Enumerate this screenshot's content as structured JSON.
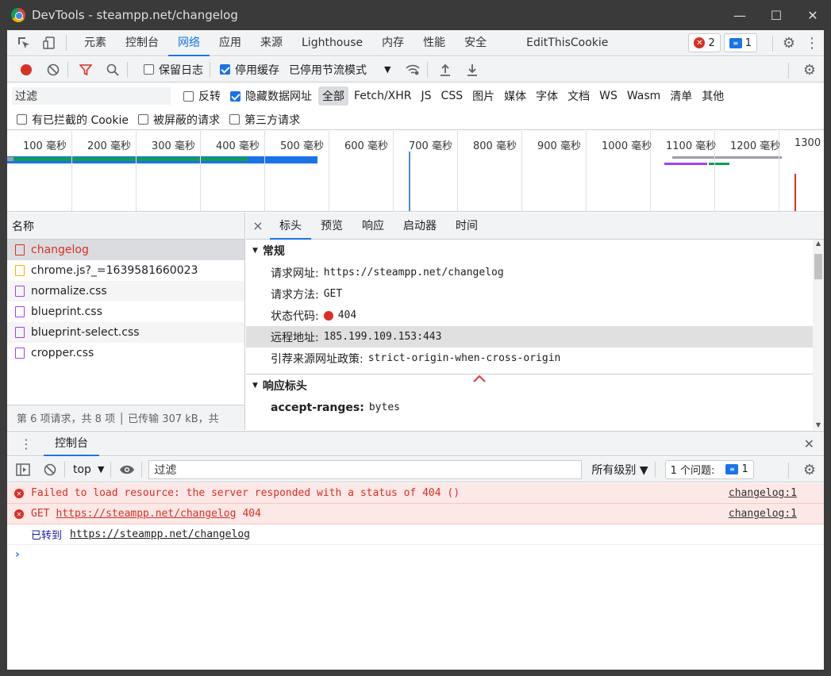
{
  "window": {
    "title": "DevTools - steampp.net/changelog",
    "minimize": "—",
    "maximize": "☐",
    "close": "✕"
  },
  "main_tabs": {
    "items": [
      "元素",
      "控制台",
      "网络",
      "应用",
      "来源",
      "Lighthouse",
      "内存",
      "性能",
      "安全"
    ],
    "extension": "EditThisCookie",
    "active": "网络",
    "error_count": "2",
    "message_count": "1"
  },
  "toolbar": {
    "preserve_log": "保留日志",
    "disable_cache": "停用缓存",
    "throttling": "已停用节流模式"
  },
  "filter": {
    "placeholder": "过滤",
    "invert": "反转",
    "hide_data_urls": "隐藏数据网址",
    "types": [
      "全部",
      "Fetch/XHR",
      "JS",
      "CSS",
      "图片",
      "媒体",
      "字体",
      "文档",
      "WS",
      "Wasm",
      "清单",
      "其他"
    ],
    "blocked_cookies": "有已拦截的 Cookie",
    "blocked_requests": "被屏蔽的请求",
    "third_party": "第三方请求"
  },
  "overview": {
    "ticks": [
      "100 毫秒",
      "200 毫秒",
      "300 毫秒",
      "400 毫秒",
      "500 毫秒",
      "600 毫秒",
      "700 毫秒",
      "800 毫秒",
      "900 毫秒",
      "1000 毫秒",
      "1100 毫秒",
      "1200 毫秒",
      "1300"
    ]
  },
  "requests": {
    "header": "名称",
    "items": [
      {
        "name": "changelog",
        "type": "doc"
      },
      {
        "name": "chrome.js?_=1639581660023",
        "type": "js"
      },
      {
        "name": "normalize.css",
        "type": "css"
      },
      {
        "name": "blueprint.css",
        "type": "css"
      },
      {
        "name": "blueprint-select.css",
        "type": "css"
      },
      {
        "name": "cropper.css",
        "type": "css"
      }
    ],
    "footer": "第 6 项请求，共 8 项 │ 已传输 307 kB，共"
  },
  "details": {
    "close": "×",
    "tabs": [
      "标头",
      "预览",
      "响应",
      "启动器",
      "时间"
    ],
    "general_title": "常规",
    "general": [
      {
        "k": "请求网址:",
        "v": "https://steampp.net/changelog"
      },
      {
        "k": "请求方法:",
        "v": "GET"
      },
      {
        "k": "状态代码:",
        "v": "404"
      },
      {
        "k": "远程地址:",
        "v": "185.199.109.153:443"
      },
      {
        "k": "引荐来源网址政策:",
        "v": "strict-origin-when-cross-origin"
      }
    ],
    "response_title": "响应标头",
    "response": [
      {
        "k": "accept-ranges:",
        "v": "bytes"
      }
    ]
  },
  "drawer": {
    "tab": "控制台",
    "context": "top",
    "filter_placeholder": "过滤",
    "levels": "所有级别 ▼",
    "issues_label": "1 个问题:",
    "issues_count": "1"
  },
  "console": {
    "lines": [
      {
        "kind": "err",
        "text": "Failed to load resource: the server responded with a status of 404 ()",
        "src": "changelog:1"
      },
      {
        "kind": "err",
        "method": "GET",
        "url": "https://steampp.net/changelog",
        "status": "404",
        "src": "changelog:1"
      },
      {
        "kind": "info",
        "text": "已转到",
        "url": "https://steampp.net/changelog"
      }
    ],
    "prompt": "›"
  }
}
